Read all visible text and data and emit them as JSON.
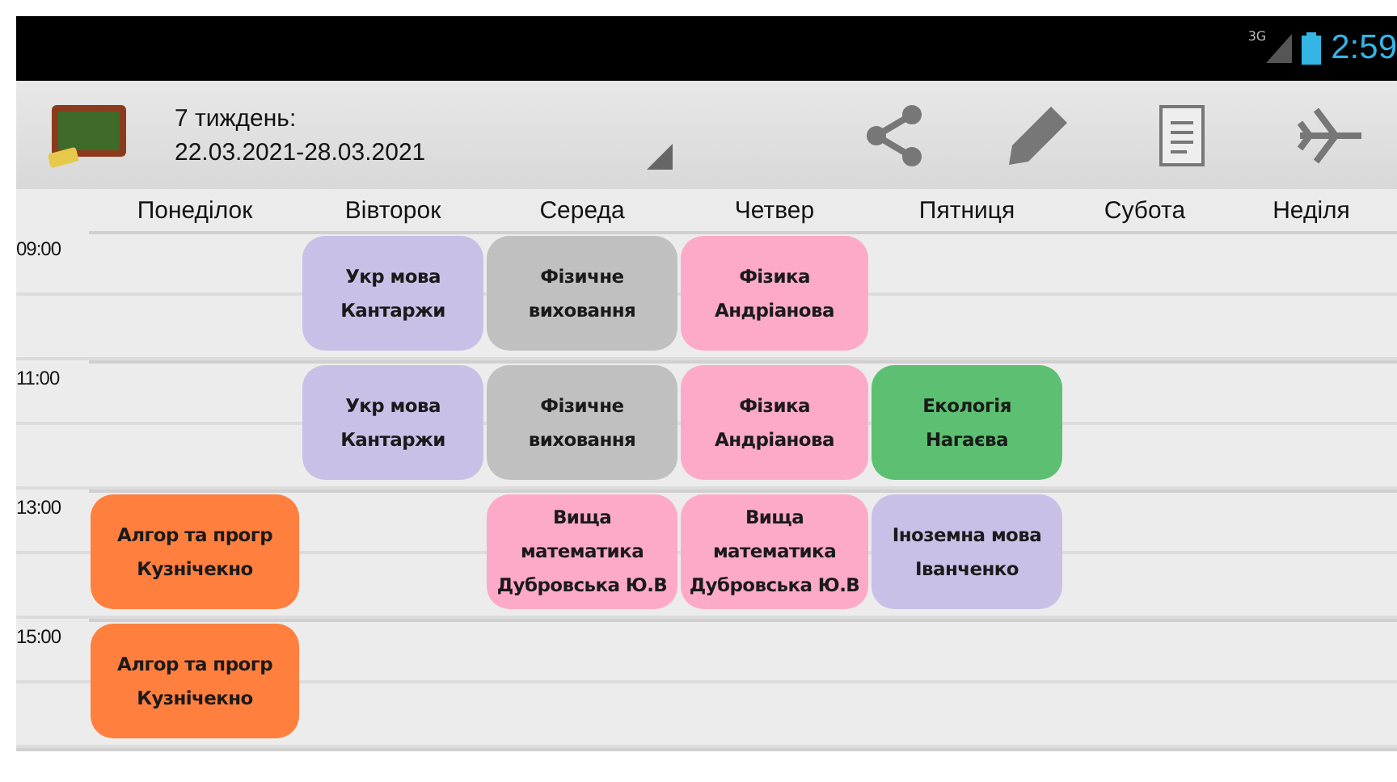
{
  "status_bar": {
    "network": "3G",
    "time": "2:59"
  },
  "action_bar": {
    "title_line1": "7 тиждень:",
    "title_line2": "22.03.2021-28.03.2021"
  },
  "days": [
    "Понеділок",
    "Вівторок",
    "Середа",
    "Четвер",
    "Пятниця",
    "Субота",
    "Неділя"
  ],
  "slots": [
    {
      "time": "09:00",
      "cells": [
        {
          "kind": "empty"
        },
        {
          "kind": "lesson",
          "color": "#c8c0e6",
          "lines": [
            "Укр мова",
            "Кантаржи"
          ]
        },
        {
          "kind": "lesson",
          "color": "#c0c0c0",
          "lines": [
            "Фізичне",
            "виховання"
          ]
        },
        {
          "kind": "lesson",
          "color": "#fdaac8",
          "lines": [
            "Фізика",
            "Андріанова"
          ]
        },
        {
          "kind": "empty"
        },
        {
          "kind": "empty"
        },
        {
          "kind": "empty"
        }
      ]
    },
    {
      "time": "11:00",
      "cells": [
        {
          "kind": "empty"
        },
        {
          "kind": "lesson",
          "color": "#c8c0e6",
          "lines": [
            "Укр мова",
            "Кантаржи"
          ]
        },
        {
          "kind": "lesson",
          "color": "#c0c0c0",
          "lines": [
            "Фізичне",
            "виховання"
          ]
        },
        {
          "kind": "lesson",
          "color": "#fdaac8",
          "lines": [
            "Фізика",
            "Андріанова"
          ]
        },
        {
          "kind": "lesson",
          "color": "#5dbf72",
          "lines": [
            "Екологія",
            "Нагаєва"
          ]
        },
        {
          "kind": "empty"
        },
        {
          "kind": "empty"
        }
      ]
    },
    {
      "time": "13:00",
      "cells": [
        {
          "kind": "lesson",
          "color": "#ff7f3f",
          "lines": [
            "Алгор та прогр",
            "Кузнічекно"
          ]
        },
        {
          "kind": "empty"
        },
        {
          "kind": "lesson",
          "color": "#fdaac8",
          "lines": [
            "Вища",
            "математика",
            "Дубровська Ю.В"
          ]
        },
        {
          "kind": "lesson",
          "color": "#fdaac8",
          "lines": [
            "Вища",
            "математика",
            "Дубровська Ю.В"
          ]
        },
        {
          "kind": "lesson",
          "color": "#c8c0e6",
          "lines": [
            "Іноземна мова",
            "Іванченко"
          ]
        },
        {
          "kind": "empty"
        },
        {
          "kind": "empty"
        }
      ]
    },
    {
      "time": "15:00",
      "cells": [
        {
          "kind": "lesson",
          "color": "#ff7f3f",
          "lines": [
            "Алгор та прогр",
            "Кузнічекно"
          ]
        },
        {
          "kind": "empty"
        },
        {
          "kind": "empty"
        },
        {
          "kind": "empty"
        },
        {
          "kind": "empty"
        },
        {
          "kind": "empty"
        },
        {
          "kind": "empty"
        }
      ]
    }
  ]
}
